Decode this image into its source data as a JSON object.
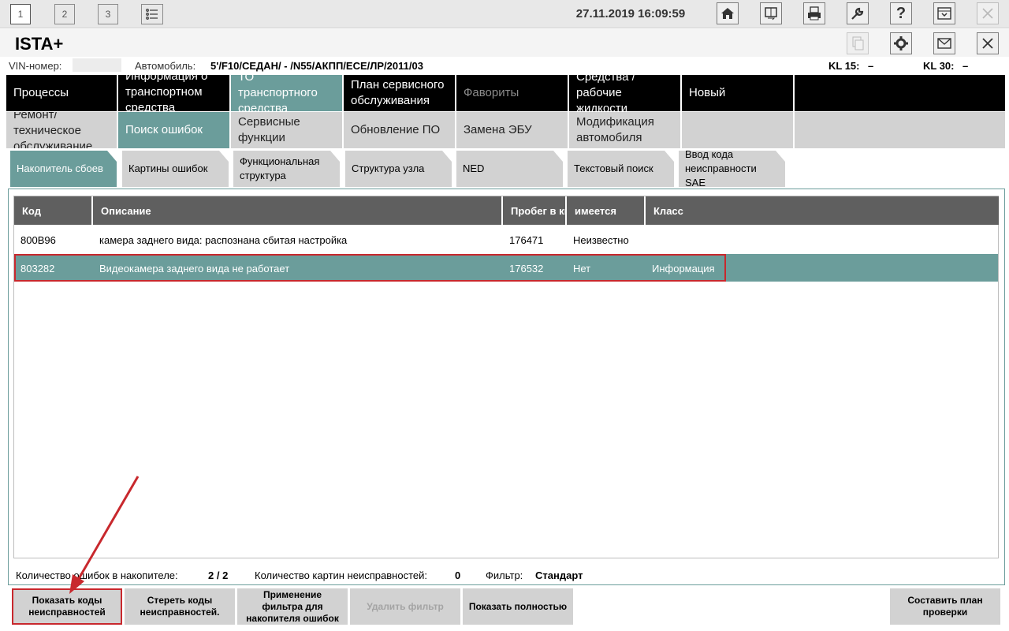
{
  "topbar": {
    "workspaces": [
      "1",
      "2",
      "3"
    ],
    "datetime": "27.11.2019 16:09:59",
    "icons": [
      "list-icon",
      "home-icon",
      "display-swap-icon",
      "printer-icon",
      "wrench-icon",
      "help-icon",
      "window-icon",
      "close-icon"
    ]
  },
  "titlebar": {
    "app_title": "ISTA+",
    "icons": [
      "copy-icon",
      "gear-icon",
      "mail-icon",
      "close-icon"
    ]
  },
  "vehicle": {
    "vin_label": "VIN-номер:",
    "vin_value": "",
    "car_label": "Автомобиль:",
    "car_value": "5'/F10/СЕДАН/ - /N55/АКПП/ECE/ЛР/2011/03",
    "kl15_label": "KL 15:",
    "kl15_value": "–",
    "kl30_label": "KL 30:",
    "kl30_value": "–"
  },
  "menu": {
    "row1": [
      {
        "label": "Процессы"
      },
      {
        "label": "Информация о транспортном средства"
      },
      {
        "label": "ТО транспортного средства"
      },
      {
        "label": "План сервисного обслуживания"
      },
      {
        "label": "Фавориты"
      },
      {
        "label": "Средства / рабочие жидкости"
      },
      {
        "label": "Новый"
      },
      {
        "label": ""
      }
    ],
    "row2": [
      {
        "label": "Ремонт/ техническое обслуживание"
      },
      {
        "label": "Поиск ошибок"
      },
      {
        "label": "Сервисные функции"
      },
      {
        "label": "Обновление ПО"
      },
      {
        "label": "Замена ЭБУ"
      },
      {
        "label": "Модификация автомобиля"
      },
      {
        "label": ""
      },
      {
        "label": ""
      }
    ]
  },
  "tabs": [
    {
      "label": "Накопитель сбоев"
    },
    {
      "label": "Картины ошибок"
    },
    {
      "label": "Функциональная структура"
    },
    {
      "label": "Структура узла"
    },
    {
      "label": "NED"
    },
    {
      "label": "Текстовый поиск"
    },
    {
      "label": "Ввод кода неисправности SAE"
    }
  ],
  "table": {
    "headers": [
      "Код",
      "Описание",
      "Пробег в км",
      "имеется",
      "Класс"
    ],
    "rows": [
      {
        "code": "800B96",
        "desc": "камера заднего вида: распознана сбитая настройка",
        "mileage": "176471",
        "present": "Неизвестно",
        "class": ""
      },
      {
        "code": "803282",
        "desc": "Видеокамера заднего вида не работает",
        "mileage": "176532",
        "present": "Нет",
        "class": "Информация"
      }
    ]
  },
  "status": {
    "count_label": "Количество ошибок в накопителе:",
    "count_value": "2 / 2",
    "pictures_label": "Количество картин неисправностей:",
    "pictures_value": "0",
    "filter_label": "Фильтр:",
    "filter_value": "Стандарт"
  },
  "buttons": {
    "show_codes": "Показать коды неисправностей",
    "clear_codes": "Стереть коды неисправностей.",
    "apply_filter": "Применение фильтра для накопителя ошибок",
    "delete_filter": "Удалить фильтр",
    "show_full": "Показать полностью",
    "make_plan": "Составить план проверки"
  },
  "colors": {
    "accent": "#6b9d9b",
    "menu_dark": "#000000",
    "menu_light": "#d2d2d2",
    "header_gray": "#5f5f5f",
    "highlight_red": "#c8282d"
  }
}
